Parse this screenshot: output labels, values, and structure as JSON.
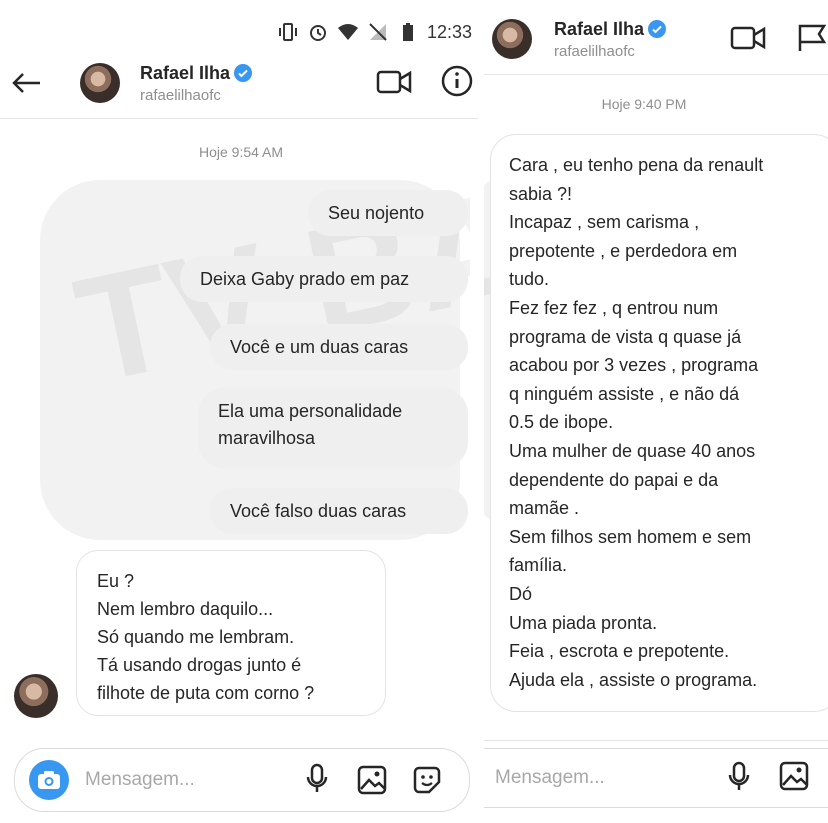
{
  "left": {
    "status": {
      "time": "12:33"
    },
    "header": {
      "name": "Rafael Ilha",
      "handle": "rafaelilhaofc"
    },
    "timestamp": "Hoje 9:54 AM",
    "messages": [
      {
        "text": "Seu nojento",
        "dir": "out"
      },
      {
        "text": "Deixa Gaby prado em paz",
        "dir": "out"
      },
      {
        "text": "Você e um duas caras",
        "dir": "out"
      },
      {
        "text": "Ela uma personalidade\nmaravilhosa",
        "dir": "out"
      },
      {
        "text": "Você falso duas caras",
        "dir": "out"
      },
      {
        "text": "Eu ?\nNem lembro daquilo...\nSó quando me lembram.\nTá usando drogas junto é\nfilhote de puta com corno ?",
        "dir": "in"
      }
    ],
    "composer": {
      "placeholder": "Mensagem..."
    }
  },
  "right": {
    "header": {
      "name": "Rafael Ilha",
      "handle": "rafaelilhaofc"
    },
    "timestamp": "Hoje 9:40 PM",
    "message": "Cara , eu tenho pena da renault\nsabia ?!\nIncapaz , sem carisma ,\nprepotente , e perdedora em\ntudo.\nFez fez fez , q entrou num\nprograma de vista q quase já\nacabou por 3 vezes , programa\nq ninguém assiste , e não dá\n0.5 de ibope.\nUma mulher de quase 40 anos\ndependente do papai e da\nmamãe .\nSem filhos sem homem e sem\nfamília.\nDó\nUma piada pronta.\nFeia , escrota e prepotente.\nAjuda ela , assiste o programa.",
    "composer": {
      "placeholder": "Mensagem..."
    }
  },
  "watermark": {
    "text": "TV BAND",
    "color": "#000000"
  },
  "colors": {
    "accent": "#3897f0",
    "verified": "#3897f0",
    "bubble_out": "#efefef"
  },
  "icons": [
    "back-arrow-icon",
    "video-call-icon",
    "info-icon",
    "camera-icon",
    "microphone-icon",
    "image-icon",
    "sticker-icon",
    "verified-badge-icon",
    "flag-icon"
  ]
}
